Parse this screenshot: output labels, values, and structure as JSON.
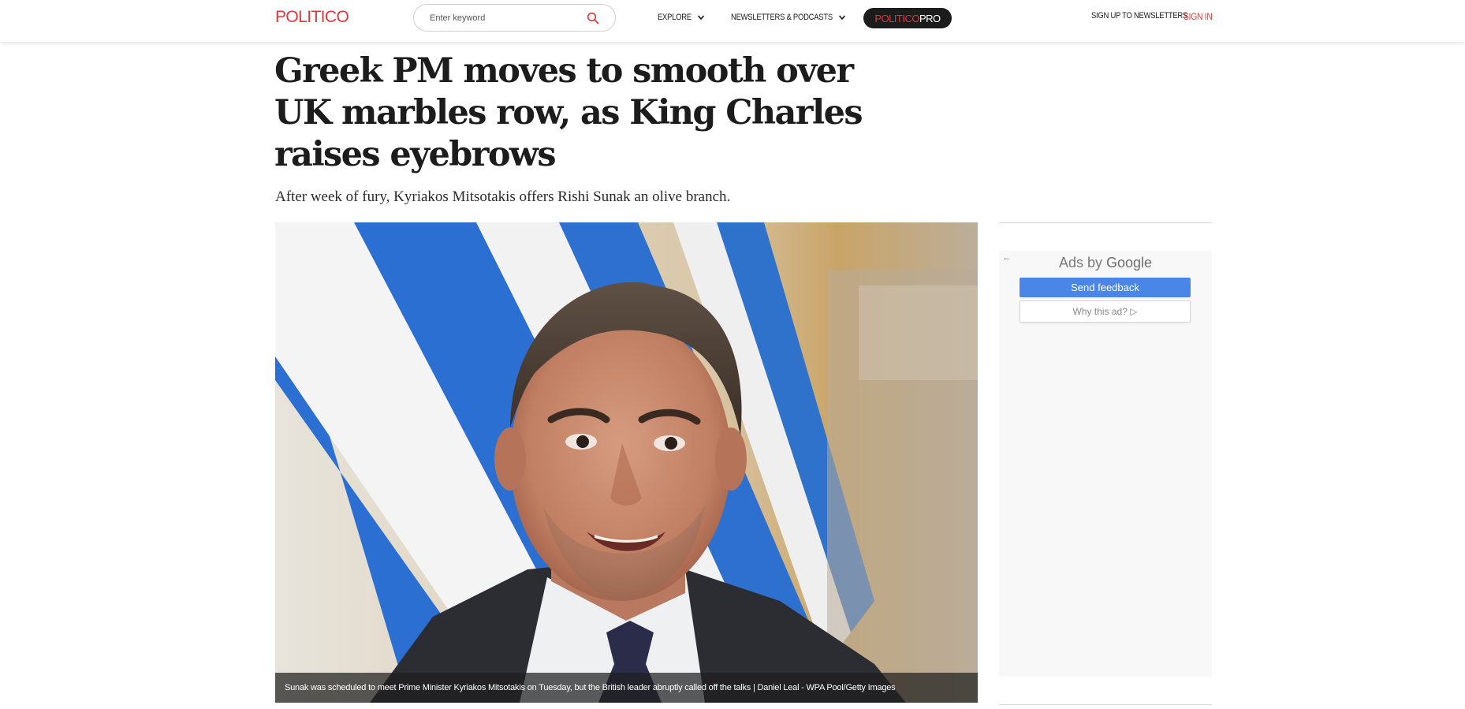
{
  "header": {
    "logo": "POLITICO",
    "search": {
      "placeholder": "Enter keyword",
      "value": ""
    },
    "nav": [
      {
        "label": "EXPLORE"
      },
      {
        "label": "NEWSLETTERS & PODCASTS"
      }
    ],
    "pro_badge": {
      "part1": "POLITICO",
      "part2": "PRO"
    },
    "signup_label": "SIGN UP TO NEWSLETTERS",
    "signin_label": "SIGN IN",
    "colors": {
      "brand_red": "#dc3a3a",
      "pro_bg": "#1c1c1c"
    }
  },
  "article": {
    "headline": "Greek PM moves to smooth over UK marbles row, as King Charles raises eyebrows",
    "dek": "After week of fury, Kyriakos Mitsotakis offers Rishi Sunak an olive branch.",
    "lead_image": {
      "caption": "Sunak was scheduled to meet Prime Minister Kyriakos Mitsotakis on Tuesday, but the British leader abruptly called off the talks | Daniel Leal - WPA Pool/Getty Images"
    }
  },
  "ad": {
    "back_icon": "←",
    "ads_by": "Ads by ",
    "ads_brand": "Google",
    "send_feedback": "Send feedback",
    "why_this_ad": "Why this ad? ▷",
    "colors": {
      "button": "#4a86e8"
    }
  }
}
